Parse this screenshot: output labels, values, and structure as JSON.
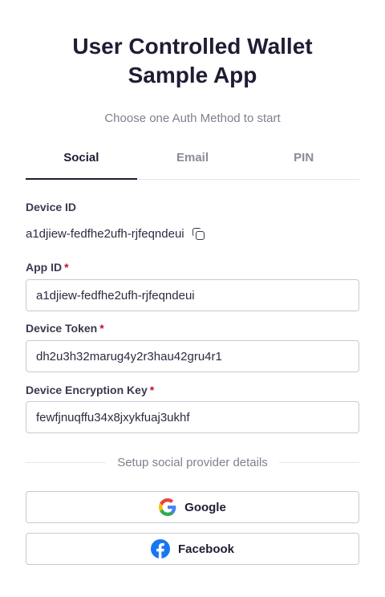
{
  "header": {
    "title_line1": "User Controlled Wallet",
    "title_line2": "Sample App",
    "subtitle": "Choose one Auth Method to start"
  },
  "tabs": [
    {
      "label": "Social",
      "active": true
    },
    {
      "label": "Email",
      "active": false
    },
    {
      "label": "PIN",
      "active": false
    }
  ],
  "device": {
    "label": "Device ID",
    "value": "a1djiew-fedfhe2ufh-rjfeqndeui"
  },
  "form": {
    "app_id": {
      "label": "App ID",
      "required_mark": "*",
      "value": "a1djiew-fedfhe2ufh-rjfeqndeui"
    },
    "device_token": {
      "label": "Device Token",
      "required_mark": "*",
      "value": "dh2u3h32marug4y2r3hau42gru4r1"
    },
    "device_encryption_key": {
      "label": "Device Encryption Key",
      "required_mark": "*",
      "value": "fewfjnuqffu34x8jxykfuaj3ukhf"
    }
  },
  "social": {
    "divider_text": "Setup social provider details",
    "google_label": "Google",
    "facebook_label": "Facebook"
  },
  "colors": {
    "primary_text": "#1e1d33",
    "muted_text": "#80808f",
    "required": "#c0102a",
    "facebook_blue": "#1877f2"
  }
}
